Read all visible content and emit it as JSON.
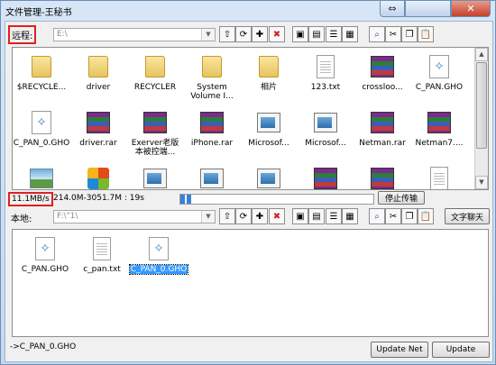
{
  "window": {
    "title": "文件管理-王秘书"
  },
  "remote": {
    "label": "远程:",
    "path": "E:\\",
    "files": [
      {
        "name": "$RECYCLE...",
        "icon": "folder-icon",
        "type": "folder"
      },
      {
        "name": "driver",
        "icon": "folder-icon",
        "type": "folder"
      },
      {
        "name": "RECYCLER",
        "icon": "folder-icon",
        "type": "folder"
      },
      {
        "name": "System\nVolume I...",
        "icon": "folder-icon",
        "type": "folder"
      },
      {
        "name": "相片",
        "icon": "folder-icon",
        "type": "folder"
      },
      {
        "name": "123.txt",
        "icon": "text-file-icon",
        "type": "doc"
      },
      {
        "name": "crossloo...",
        "icon": "rar-archive-icon",
        "type": "rar"
      },
      {
        "name": "C_PAN.GHO",
        "icon": "ghost-file-icon",
        "type": "ghost"
      },
      {
        "name": "C_PAN_0.GHO",
        "icon": "ghost-file-icon",
        "type": "ghost"
      },
      {
        "name": "driver.rar",
        "icon": "rar-archive-icon",
        "type": "rar"
      },
      {
        "name": "Exerver老版\n本被控端...",
        "icon": "rar-archive-icon",
        "type": "rar"
      },
      {
        "name": "iPhone.rar",
        "icon": "rar-archive-icon",
        "type": "rar"
      },
      {
        "name": "Microsof...",
        "icon": "executable-icon",
        "type": "exe"
      },
      {
        "name": "Microsof...",
        "icon": "executable-icon",
        "type": "exe"
      },
      {
        "name": "Netman.rar",
        "icon": "rar-archive-icon",
        "type": "rar"
      },
      {
        "name": "Netman7....",
        "icon": "rar-archive-icon",
        "type": "rar"
      },
      {
        "name": "",
        "icon": "image-file-icon",
        "type": "img"
      },
      {
        "name": "",
        "icon": "office-icon",
        "type": "office"
      },
      {
        "name": "",
        "icon": "executable-icon",
        "type": "exe"
      },
      {
        "name": "",
        "icon": "executable-icon",
        "type": "exe"
      },
      {
        "name": "",
        "icon": "executable-icon",
        "type": "exe"
      },
      {
        "name": "",
        "icon": "rar-archive-icon",
        "type": "rar"
      },
      {
        "name": "",
        "icon": "rar-archive-icon",
        "type": "rar"
      },
      {
        "name": "",
        "icon": "text-file-icon",
        "type": "doc"
      }
    ]
  },
  "transfer": {
    "speed": "11.1MB/s",
    "info": "214.0M-3051.7M : 19s",
    "progress": 0.04,
    "stop_label": "停止传输"
  },
  "local": {
    "label": "本地:",
    "path": "F:\\\"1\\",
    "chat_label": "文字聊天",
    "files": [
      {
        "name": "C_PAN.GHO",
        "icon": "ghost-file-icon",
        "type": "ghost"
      },
      {
        "name": "c_pan.txt",
        "icon": "text-file-icon",
        "type": "doc"
      },
      {
        "name": "C_PAN_0.GHO",
        "icon": "ghost-file-icon",
        "type": "ghost",
        "selected": true
      }
    ]
  },
  "status": {
    "text": "->C_PAN_0.GHO"
  },
  "buttons": {
    "update_net": "Update Net",
    "update": "Update"
  },
  "toolbar_icons": [
    "folder-up-icon",
    "folder-refresh-icon",
    "new-folder-icon",
    "delete-icon",
    "large-icons-view-icon",
    "small-icons-view-icon",
    "list-view-icon",
    "details-view-icon",
    "search-icon",
    "cut-icon",
    "copy-icon",
    "paste-icon"
  ],
  "colors": {
    "highlight": "#e02020",
    "selection": "#3399ff",
    "progress": "#3b7fd8"
  }
}
